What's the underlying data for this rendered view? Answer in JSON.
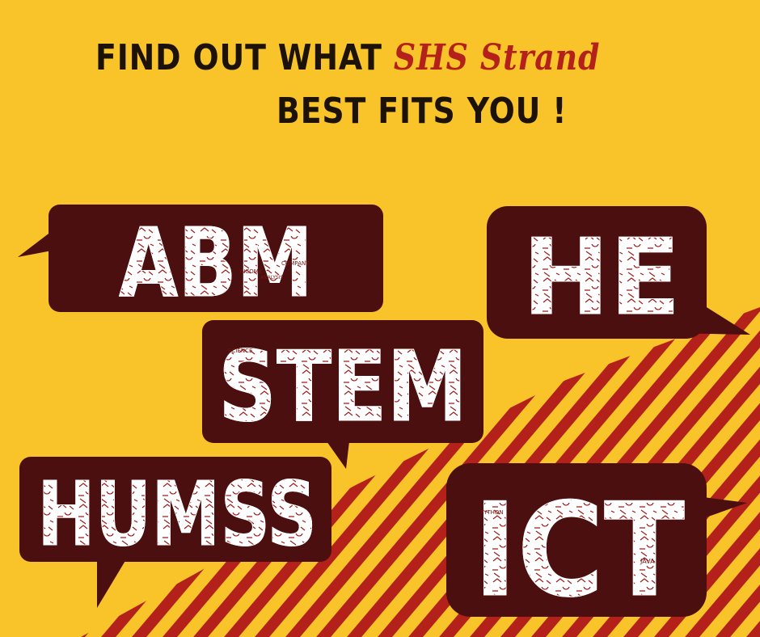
{
  "headline": {
    "line1_prefix": "FIND OUT WHAT",
    "line1_accent": "SHS Strand",
    "line2": "BEST FITS YOU !"
  },
  "strands": {
    "abm": "ABM",
    "he": "HE",
    "stem": "STEM",
    "humss": "HUMSS",
    "ict": "ICT"
  },
  "doodle_labels": {
    "income": "INCOME",
    "company": "COMPANY",
    "analysis": "ANALYSIS",
    "science": "SCIENCE",
    "python": "PYTHON",
    "java": "JAVA"
  },
  "colors": {
    "background": "#f8c42a",
    "bubble": "#4a0f0e",
    "stripe": "#b3211a",
    "accent_text": "#b3211a",
    "headline_text": "#1c1208",
    "letters": "#ffffff"
  }
}
